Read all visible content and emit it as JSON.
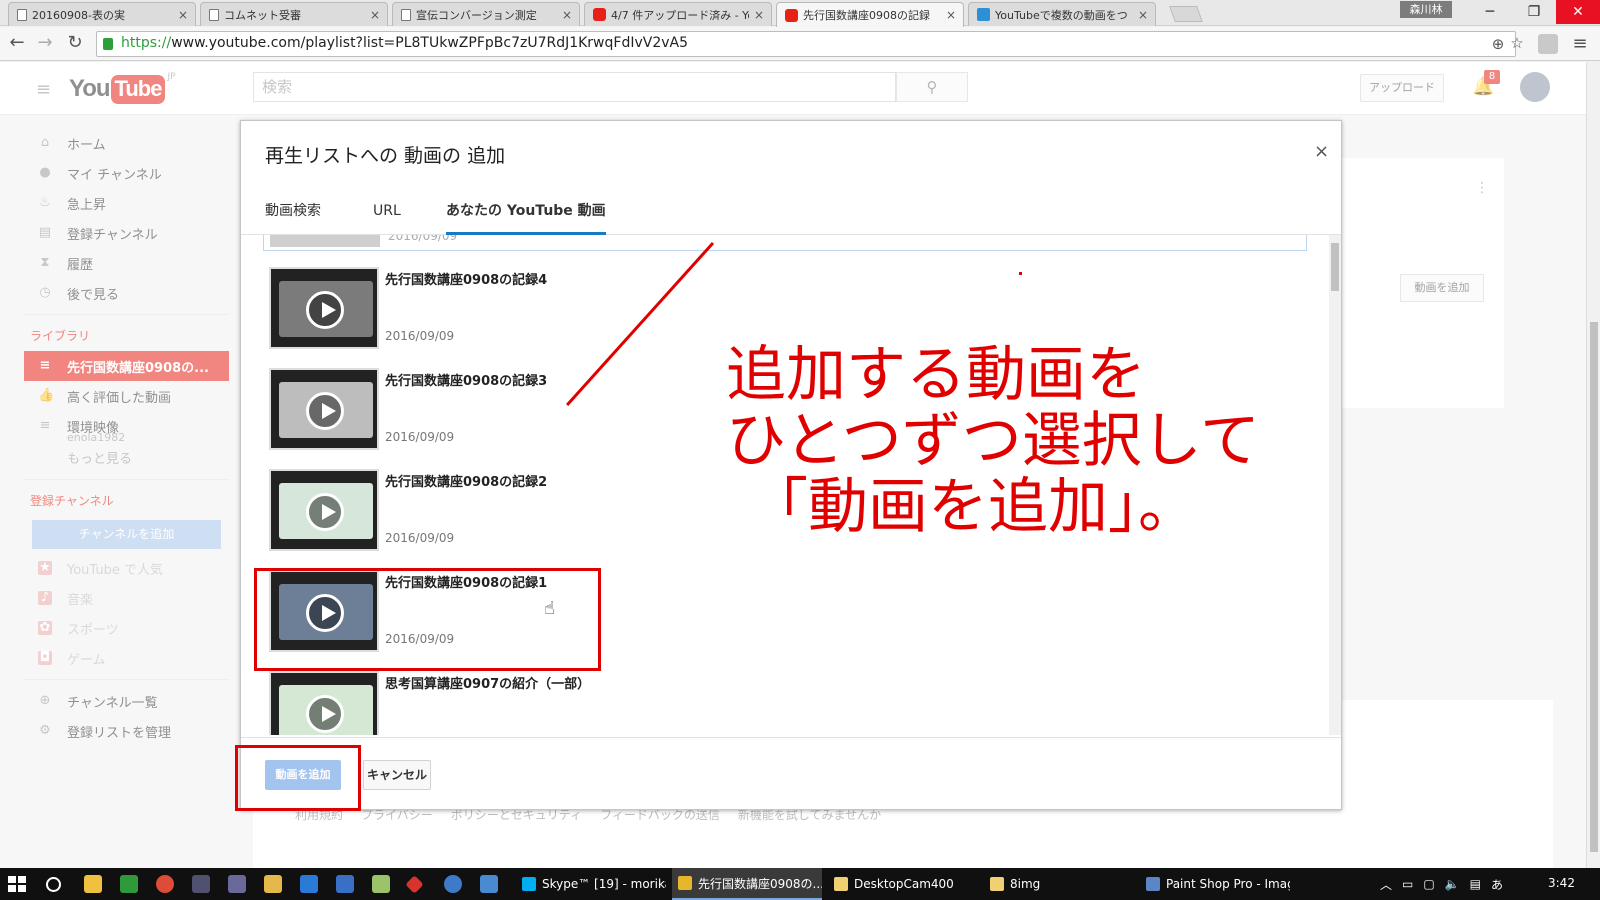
{
  "browser": {
    "tabs": [
      {
        "title": "20160908-表の実",
        "icon": "doc"
      },
      {
        "title": "コムネット受審",
        "icon": "doc"
      },
      {
        "title": "宣伝コンバージョン測定",
        "icon": "doc"
      },
      {
        "title": "4/7 件アップロード済み - You",
        "icon": "yt"
      },
      {
        "title": "先行国数講座0908の記録",
        "icon": "yt"
      },
      {
        "title": "YouTubeで複数の動画をつ",
        "icon": "dc"
      }
    ],
    "active_tab": 4,
    "user_name": "森川林",
    "url_scheme": "https://",
    "url_rest": "www.youtube.com/playlist?list=PL8TUkwZPFpBc7zU7RdJ1KrwqFdIvV2vA5"
  },
  "youtube": {
    "logo_you": "You",
    "logo_tube": "Tube",
    "logo_region": "JP",
    "search_placeholder": "検索",
    "upload_label": "アップロード",
    "notification_count": "8",
    "guide": {
      "main": [
        {
          "label": "ホーム",
          "icon": "home-icon",
          "glyph": "⌂"
        },
        {
          "label": "マイ チャンネル",
          "icon": "user-icon",
          "glyph": "●"
        },
        {
          "label": "急上昇",
          "icon": "flame-icon",
          "glyph": "♨"
        },
        {
          "label": "登録チャンネル",
          "icon": "subscriptions-icon",
          "glyph": "▤"
        },
        {
          "label": "履歴",
          "icon": "history-icon",
          "glyph": "⧗"
        },
        {
          "label": "後で見る",
          "icon": "clock-icon",
          "glyph": "◷"
        }
      ],
      "library_title": "ライブラリ",
      "library": [
        {
          "label": "先行国数講座0908の...",
          "icon": "playlist-icon",
          "glyph": "≡",
          "active": true
        },
        {
          "label": "高く評価した動画",
          "icon": "thumbs-up-icon",
          "glyph": "👍",
          "active": false
        },
        {
          "label": "環境映像",
          "icon": "playlist-icon",
          "glyph": "≡",
          "active": false
        }
      ],
      "library_sub": "enola1982",
      "more_label": "もっと見る",
      "subs_title": "登録チャンネル",
      "add_channel_label": "チャンネルを追加",
      "subs": [
        {
          "label": "YouTube で人気",
          "icon": "star-icon",
          "glyph": "★"
        },
        {
          "label": "音楽",
          "icon": "music-icon",
          "glyph": "♪"
        },
        {
          "label": "スポーツ",
          "icon": "sports-icon",
          "glyph": "✿"
        },
        {
          "label": "ゲーム",
          "icon": "gamepad-icon",
          "glyph": "◘"
        }
      ],
      "bottom": [
        {
          "label": "チャンネル一覧",
          "icon": "add-circle-icon",
          "glyph": "⊕"
        },
        {
          "label": "登録リストを管理",
          "icon": "gear-icon",
          "glyph": "⚙"
        }
      ]
    },
    "right_add_video_label": "動画を追加",
    "footer_links": [
      "利用規約",
      "プライバシー",
      "ポリシーとセキュリティ",
      "フィードバックの送信",
      "新機能を試してみませんか"
    ]
  },
  "modal": {
    "title": "再生リストへの 動画の 追加",
    "close_glyph": "×",
    "tabs": [
      "動画検索",
      "URL",
      "あなたの YouTube 動画"
    ],
    "active_tab": 2,
    "prev_item_date": "2016/09/09",
    "videos": [
      {
        "title": "先行国数講座0908の記録4",
        "date": "2016/09/09",
        "scene": "#7b7b7b"
      },
      {
        "title": "先行国数講座0908の記録3",
        "date": "2016/09/09",
        "scene": "#bdbdbd"
      },
      {
        "title": "先行国数講座0908の記録2",
        "date": "2016/09/09",
        "scene": "#d7e6da"
      },
      {
        "title": "先行国数講座0908の記録1",
        "date": "2016/09/09",
        "scene": "#6d7f97"
      },
      {
        "title": "思考国算講座0907の紹介（一部）",
        "date": "",
        "scene": "#d4e8d4"
      }
    ],
    "add_button_label": "動画を追加",
    "cancel_button_label": "キャンセル"
  },
  "annotation": {
    "line1": "追加する動画を",
    "line2": "ひとつずつ選択して",
    "line3": "「動画を追加」。",
    "color": "#e00000"
  },
  "taskbar": {
    "apps": [
      {
        "label": "Skype™ [19] - morika...",
        "color": "#00aff0"
      },
      {
        "label": "先行国数講座0908の...",
        "color": "#e8b62c"
      },
      {
        "label": "DesktopCam400",
        "color": "#f0d070"
      },
      {
        "label": "8img",
        "color": "#f0d070"
      },
      {
        "label": "Paint Shop Pro - Imag...",
        "color": "#5a86c5"
      }
    ],
    "ime": "あ",
    "time": "3:42"
  }
}
